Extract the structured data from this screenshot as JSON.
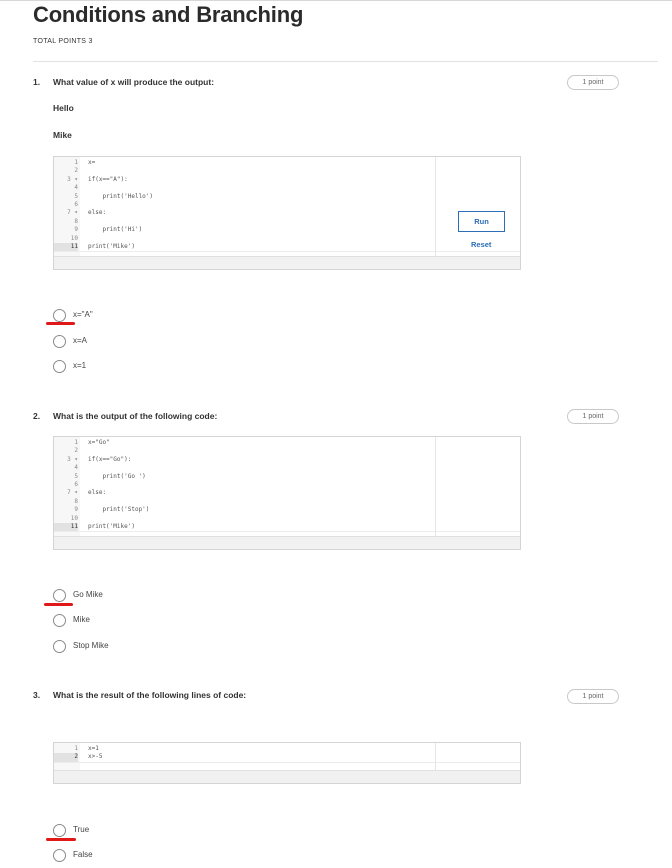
{
  "page": {
    "title": "Conditions and Branching",
    "total_points": "TOTAL POINTS 3"
  },
  "colors": {
    "accent": "#2d6db5",
    "annotation": "#e01818"
  },
  "questions": [
    {
      "number": "1.",
      "text": "What value of x will produce the output:",
      "points": "1 point",
      "extra_lines": [
        "Hello",
        "Mike"
      ],
      "code": [
        {
          "n": "1",
          "t": "x="
        },
        {
          "n": "2",
          "t": ""
        },
        {
          "n": "3 ▾",
          "t": "if(x==\"A\"):"
        },
        {
          "n": "4",
          "t": ""
        },
        {
          "n": "5",
          "t": "    print('Hello')"
        },
        {
          "n": "6",
          "t": ""
        },
        {
          "n": "7 ▾",
          "t": "else:"
        },
        {
          "n": "8",
          "t": ""
        },
        {
          "n": "9",
          "t": "    print('Hi')"
        },
        {
          "n": "10",
          "t": ""
        },
        {
          "n": "11",
          "t": "print('Mike')"
        }
      ],
      "run_label": "Run",
      "reset_label": "Reset",
      "options": [
        "x=\"A\"",
        "x=A",
        "x=1"
      ]
    },
    {
      "number": "2.",
      "text": "What is the output of the following code:",
      "points": "1 point",
      "code": [
        {
          "n": "1",
          "t": "x=\"Go\""
        },
        {
          "n": "2",
          "t": ""
        },
        {
          "n": "3 ▾",
          "t": "if(x==\"Go\"):"
        },
        {
          "n": "4",
          "t": ""
        },
        {
          "n": "5",
          "t": "    print('Go ')"
        },
        {
          "n": "6",
          "t": ""
        },
        {
          "n": "7 ▾",
          "t": "else:"
        },
        {
          "n": "8",
          "t": ""
        },
        {
          "n": "9",
          "t": "    print('Stop')"
        },
        {
          "n": "10",
          "t": ""
        },
        {
          "n": "11",
          "t": "print('Mike')"
        }
      ],
      "options": [
        "Go Mike",
        "Mike",
        "Stop Mike"
      ]
    },
    {
      "number": "3.",
      "text": "What is the result of the following lines of code:",
      "points": "1 point",
      "code": [
        {
          "n": "1",
          "t": "x=1"
        },
        {
          "n": "2",
          "t": "x>-5"
        }
      ],
      "options": [
        "True",
        "False"
      ]
    }
  ]
}
